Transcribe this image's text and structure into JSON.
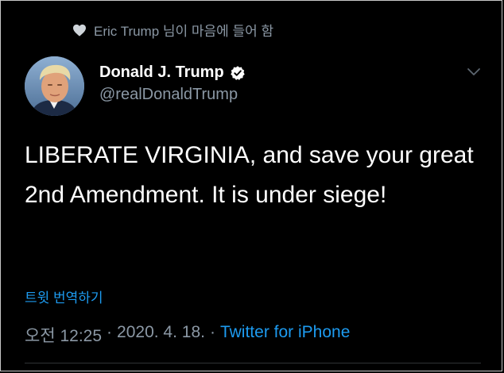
{
  "social_context": {
    "icon": "heart-icon",
    "text": "Eric Trump 님이 마음에 들어 함"
  },
  "author": {
    "display_name": "Donald J. Trump",
    "verified_icon": "verified-badge-icon",
    "handle": "@realDonaldTrump"
  },
  "tweet": {
    "text": "LIBERATE VIRGINIA, and save your great 2nd Amendment. It is under siege!",
    "translate_label": "트윗 번역하기",
    "time": "오전 12:25",
    "separator": "·",
    "date": "2020. 4. 18.",
    "source": "Twitter for iPhone"
  },
  "colors": {
    "background": "#000000",
    "text_primary": "#ffffff",
    "text_secondary": "#8b98a5",
    "link": "#1d9bf0"
  }
}
